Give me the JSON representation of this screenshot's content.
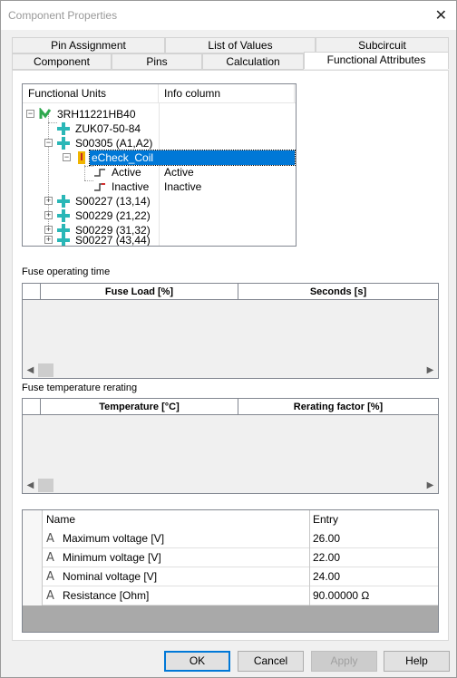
{
  "window": {
    "title": "Component Properties",
    "close_glyph": "✕"
  },
  "tabs": {
    "row_back": [
      "Pin Assignment",
      "List of Values",
      "Subcircuit"
    ],
    "row_front": [
      "Component",
      "Pins",
      "Calculation",
      "Functional Attributes"
    ],
    "active": "Functional Attributes"
  },
  "tree": {
    "col_functional_units": "Functional Units",
    "col_info": "Info column",
    "nodes": [
      {
        "label": "3RH11221HB40",
        "icon": "device-green-icon",
        "info": ""
      },
      {
        "label": "ZUK07-50-84",
        "icon": "connector-cyan-icon",
        "info": ""
      },
      {
        "label": "S00305 (A1,A2)",
        "icon": "connector-cyan-icon",
        "info": ""
      },
      {
        "label": "eCheck_Coil",
        "icon": "coil-yellow-icon",
        "info": "",
        "selected": true
      },
      {
        "label": "Active",
        "icon": "state-active-icon",
        "info": "Active"
      },
      {
        "label": "Inactive",
        "icon": "state-inactive-icon",
        "info": "Inactive"
      },
      {
        "label": "S00227 (13,14)",
        "icon": "connector-cyan-icon",
        "info": ""
      },
      {
        "label": "S00229 (21,22)",
        "icon": "connector-cyan-icon",
        "info": ""
      },
      {
        "label": "S00229 (31,32)",
        "icon": "connector-cyan-icon",
        "info": ""
      },
      {
        "label": "S00227 (43,44)",
        "icon": "connector-cyan-icon",
        "info": ""
      }
    ]
  },
  "fuse_time": {
    "label": "Fuse operating time",
    "columns": [
      "Fuse Load [%]",
      "Seconds [s]"
    ]
  },
  "fuse_temp": {
    "label": "Fuse temperature rerating",
    "columns": [
      "Temperature [°C]",
      "Rerating factor [%]"
    ]
  },
  "attributes": {
    "col_name": "Name",
    "col_entry": "Entry",
    "rows": [
      {
        "name": "Maximum voltage [V]",
        "entry": "26.00"
      },
      {
        "name": "Minimum voltage [V]",
        "entry": "22.00"
      },
      {
        "name": "Nominal voltage [V]",
        "entry": "24.00"
      },
      {
        "name": "Resistance [Ohm]",
        "entry": "90.00000 Ω"
      }
    ]
  },
  "buttons": {
    "ok": "OK",
    "cancel": "Cancel",
    "apply": "Apply",
    "help": "Help"
  },
  "colors": {
    "selection": "#0078d7",
    "device_green": "#2fa94e",
    "connector_cyan": "#2ab7b7",
    "coil_yellow": "#f0b400"
  }
}
